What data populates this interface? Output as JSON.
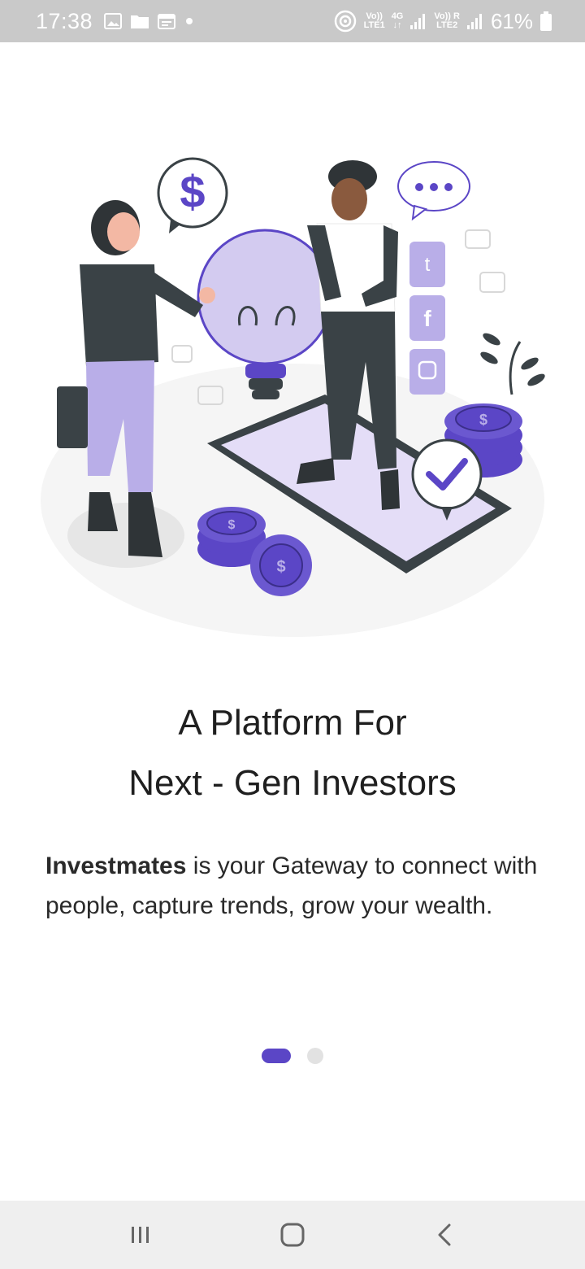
{
  "status_bar": {
    "time": "17:38",
    "network_1_top": "Vo))",
    "network_1_bottom": "LTE1",
    "network_type": "4G",
    "network_2_top": "Vo)) R",
    "network_2_bottom": "LTE2",
    "battery": "61%",
    "icons": [
      "image-icon",
      "folder-icon",
      "calendar-icon",
      "dot-icon",
      "hotspot-icon",
      "signal-icon",
      "battery-icon"
    ]
  },
  "onboarding": {
    "title_line1": "A Platform For",
    "title_line2": "Next - Gen Investors",
    "brand": "Investmates",
    "description": " is your Gateway to connect with people, capture trends, grow your wealth.",
    "page_indicator": {
      "current": 1,
      "total": 2
    }
  },
  "colors": {
    "accent": "#5b46c6",
    "lavender": "#b9aee8",
    "dark": "#3a4246",
    "statusbar": "#c9c9c9"
  },
  "nav": {
    "icons": [
      "recent-apps-icon",
      "home-icon",
      "back-icon"
    ]
  }
}
